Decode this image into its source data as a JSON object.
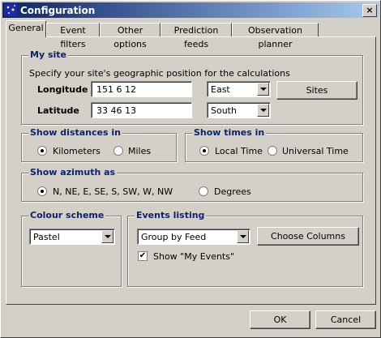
{
  "window": {
    "title": "Configuration",
    "close_glyph": "×"
  },
  "tabs": [
    {
      "label": "General",
      "active": true
    },
    {
      "label": "Event filters"
    },
    {
      "label": "Other options"
    },
    {
      "label": "Prediction feeds"
    },
    {
      "label": "Observation planner"
    }
  ],
  "my_site": {
    "title": "My site",
    "description": "Specify your site's geographic position for the calculations",
    "longitude_label": "Longitude",
    "longitude_value": "151  6 12",
    "longitude_dir": "East",
    "latitude_label": "Latitude",
    "latitude_value": "33 46 13",
    "latitude_dir": "South",
    "sites_button": "Sites"
  },
  "distances": {
    "title": "Show distances in",
    "opt1": "Kilometers",
    "opt2": "Miles",
    "selected": "Kilometers"
  },
  "times": {
    "title": "Show times in",
    "opt1": "Local Time",
    "opt2": "Universal Time",
    "selected": "Local Time"
  },
  "azimuth": {
    "title": "Show azimuth as",
    "opt1": "N, NE, E, SE, S, SW, W, NW",
    "opt2": "Degrees",
    "selected": "N, NE, E, SE, S, SW, W, NW"
  },
  "colour": {
    "title": "Colour scheme",
    "value": "Pastel"
  },
  "events": {
    "title": "Events listing",
    "value": "Group by Feed",
    "columns_button": "Choose Columns",
    "show_my_events": "Show \"My Events\"",
    "show_my_events_checked": true
  },
  "footer": {
    "ok": "OK",
    "cancel": "Cancel"
  }
}
